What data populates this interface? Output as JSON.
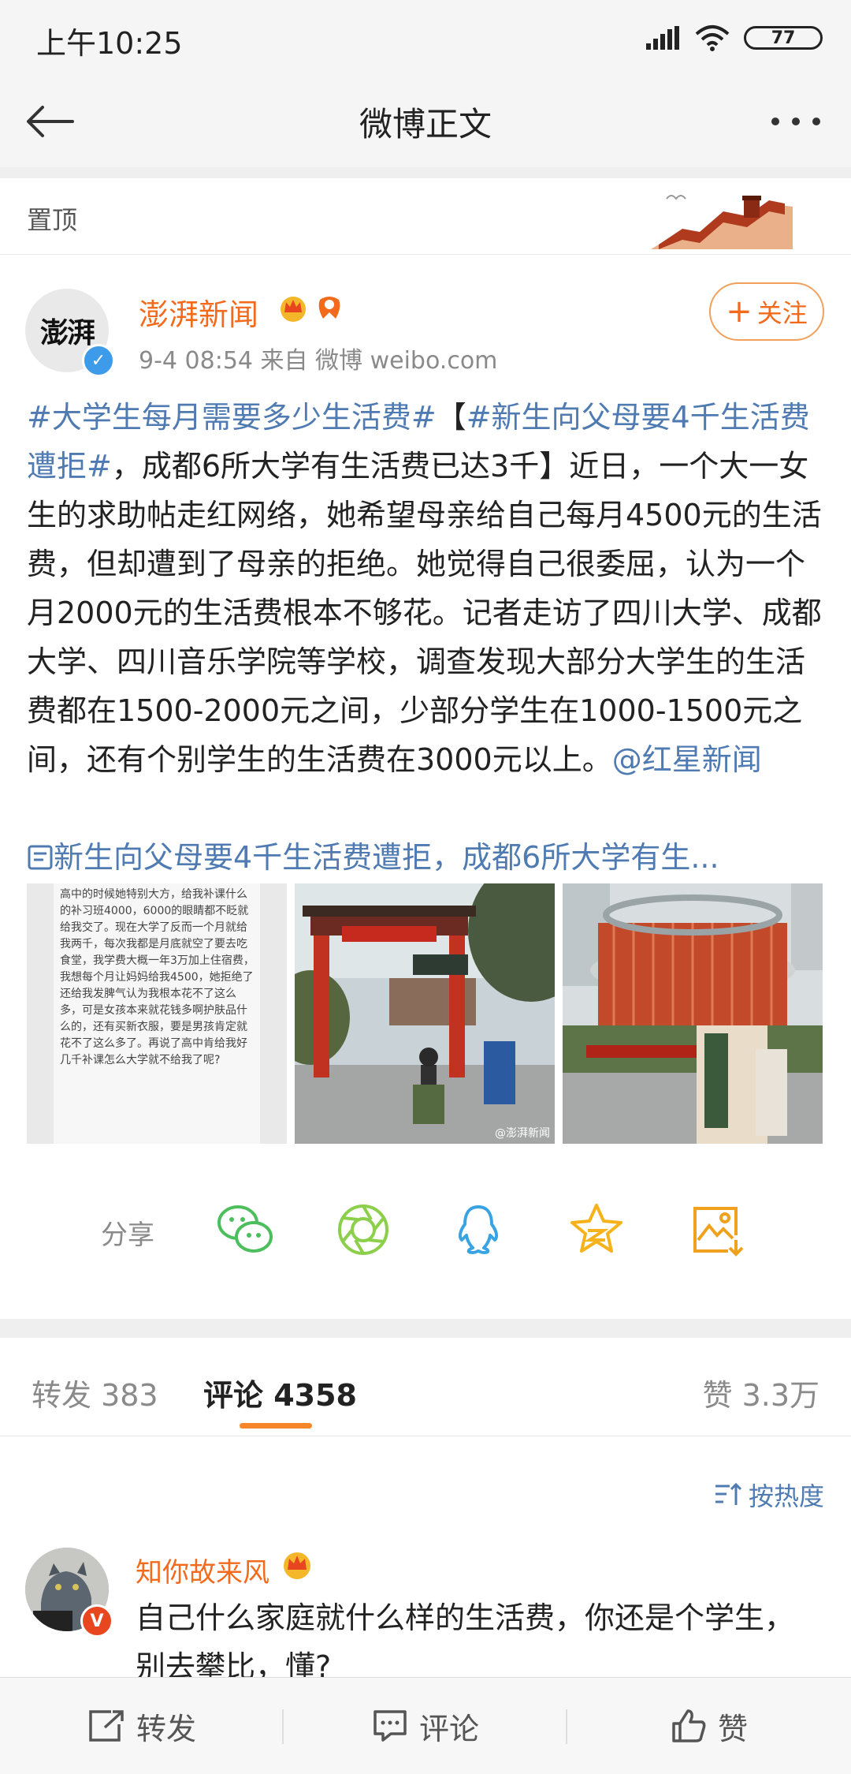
{
  "status_bar": {
    "time": "上午10:25",
    "battery": "77"
  },
  "title_bar": {
    "title": "微博正文"
  },
  "pinned": {
    "label": "置顶"
  },
  "post": {
    "avatar_text": "澎湃",
    "author": "澎湃新闻",
    "meta": "9-4 08:54  来自 微博 weibo.com",
    "follow_label": "关注",
    "hashtag1": "#大学生每月需要多少生活费#",
    "bracket_open": "【",
    "hashtag2": "#新生向父母要4千生活费遭拒#",
    "text_main": "，成都6所大学有生活费已达3千】近日，一个大一女生的求助帖走红网络，她希望母亲给自己每月4500元的生活费，但却遭到了母亲的拒绝。她觉得自己很委屈，认为一个月2000元的生活费根本不够花。记者走访了四川大学、成都大学、四川音乐学院等学校，调查发现大部分大学生的生活费都在1500-2000元之间，少部分学生在1000-1500元之间，还有个别学生的生活费在3000元以上。",
    "mention": "@红星新闻",
    "link_text": "新生向父母要4千生活费遭拒，成都6所大学有生...",
    "image1_text": "高中的时候她特别大方，给我补课什么的补习班4000，6000的眼睛都不眨就给我交了。现在大学了反而一个月就给我两千，每次我都是月底就空了要去吃食堂，我学费大概一年3万加上住宿费，我想每个月让妈妈给我4500，她拒绝了还给我发脾气认为我根本花不了这么多，可是女孩本来就花钱多啊护肤品什么的，还有买新衣服，要是男孩肯定就花不了这么多了。再说了高中肯给我好几千补课怎么大学就不给我了呢?",
    "image2_watermark": "@澎湃新闻"
  },
  "share": {
    "label": "分享",
    "icons": [
      "wechat-icon",
      "moments-icon",
      "qq-icon",
      "qzone-icon",
      "save-image-icon"
    ]
  },
  "tabs": {
    "repost": "转发 383",
    "comments": "评论 4358",
    "likes": "赞 3.3万"
  },
  "sort": {
    "label": "按热度"
  },
  "comment": {
    "name": "知你故来风",
    "text": "自己什么家庭就什么样的生活费，你还是个学生，别去攀比，懂?"
  },
  "bottom_bar": {
    "repost": "转发",
    "comment": "评论",
    "like": "赞"
  },
  "colors": {
    "accent": "#f26b1d",
    "link": "#4f7bb2",
    "tab_underline": "#f7862a",
    "verified": "#3d9be9"
  }
}
